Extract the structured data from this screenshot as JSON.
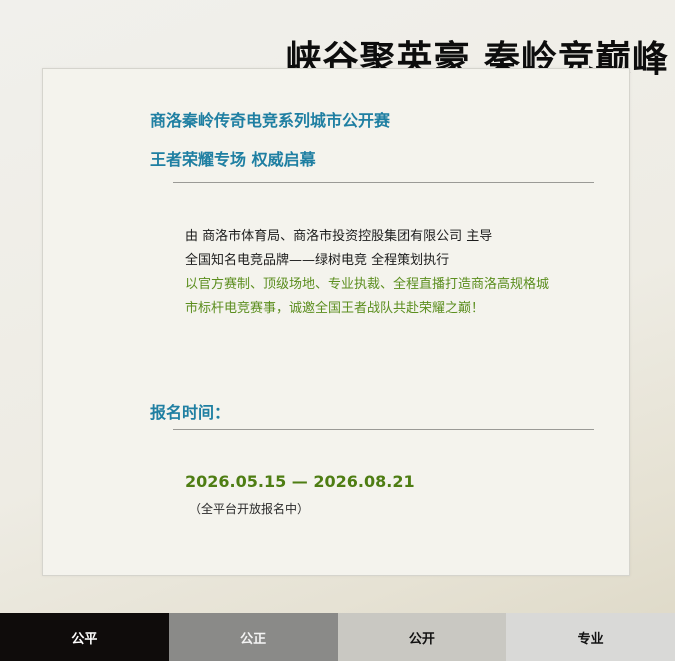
{
  "header": {
    "slogan": "峡谷聚英豪 秦岭竞巅峰"
  },
  "card": {
    "title": "商洛秦岭传奇电竞系列城市公开赛",
    "subtitle": "王者荣耀专场 权威启幕",
    "description": [
      "由 商洛市体育局、商洛市投资控股集团有限公司 主导",
      "全国知名电竞品牌——绿树电竞 全程策划执行",
      "以官方赛制、顶级场地、专业执裁、全程直播打造商洛高规格城",
      "市标杆电竞赛事，诚邀全国王者战队共赴荣耀之巅！"
    ],
    "registration": {
      "heading": "报名时间：",
      "dates": "2026.05.15 — 2026.08.21",
      "note": "（全平台开放报名中）"
    }
  },
  "tabs": [
    {
      "label": "公平"
    },
    {
      "label": "公正"
    },
    {
      "label": "公开"
    },
    {
      "label": "专业"
    }
  ],
  "colors": {
    "accent_blue": "#1f7fa2",
    "accent_green": "#5b8e1e",
    "tab_active": "#0f0c0b"
  }
}
